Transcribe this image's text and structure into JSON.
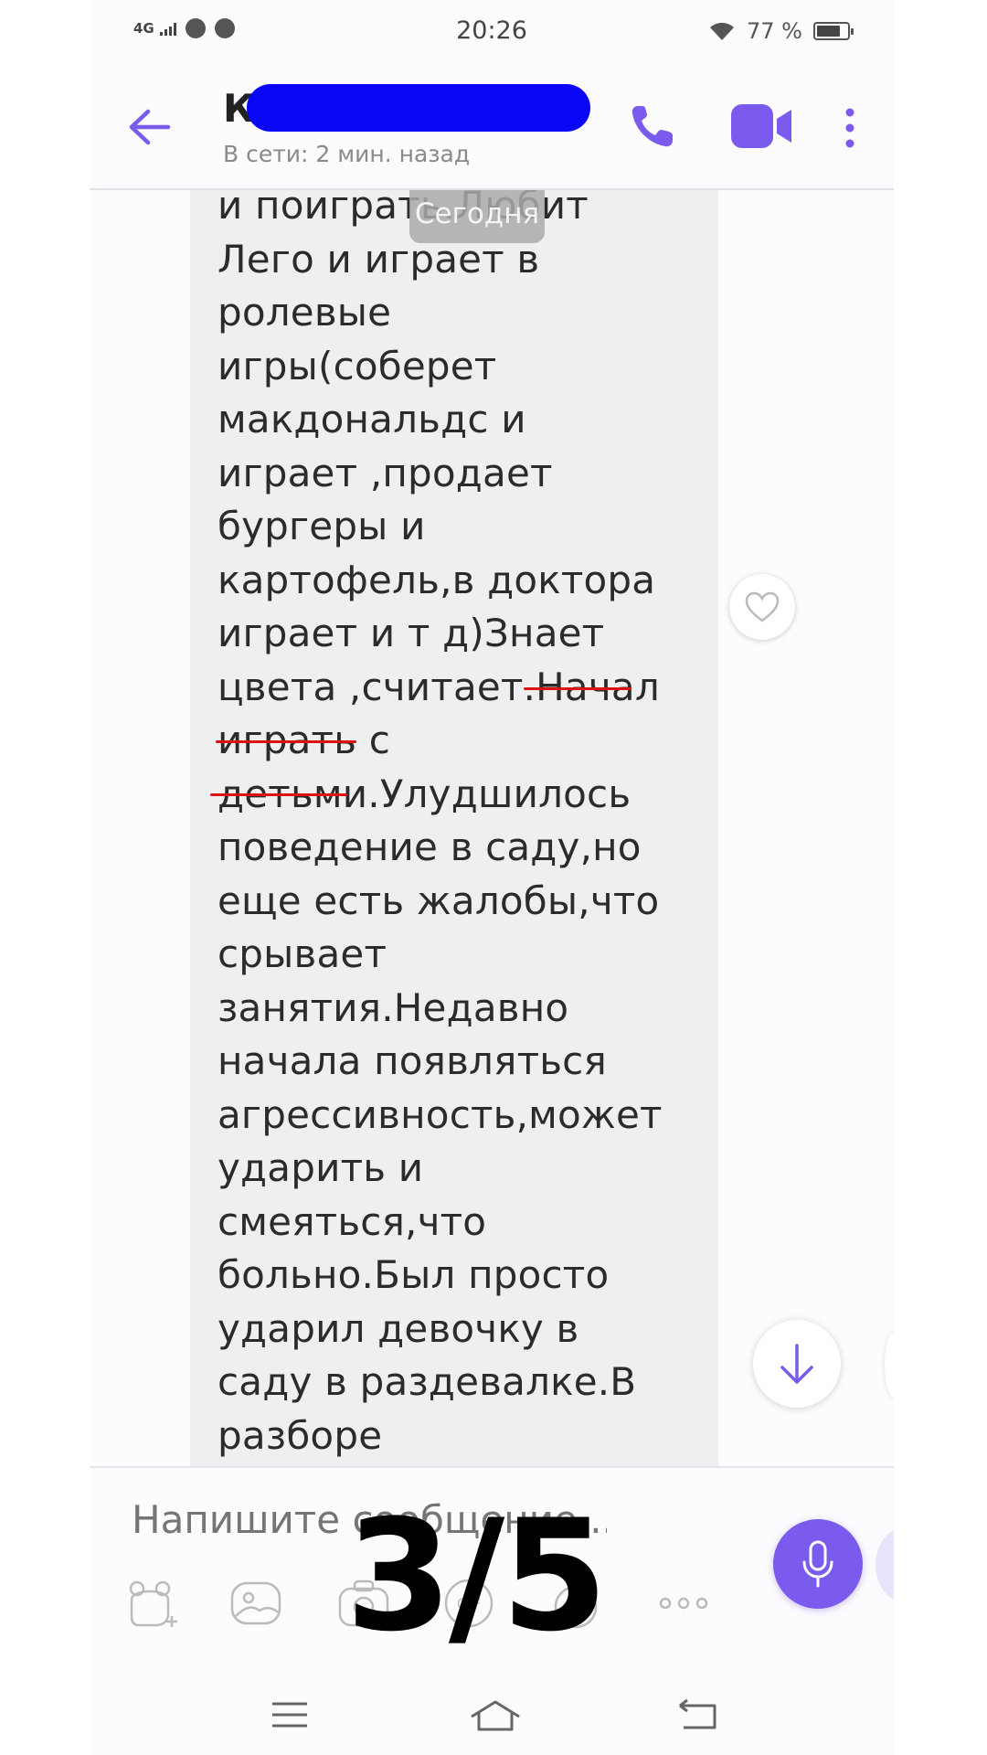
{
  "status_bar": {
    "network": "4G",
    "time": "20:26",
    "battery_text": "77 %",
    "battery_level": 0.77
  },
  "header": {
    "contact_initial": "К",
    "last_seen": "В сети: 2 мин. назад"
  },
  "chat": {
    "date_separator": "Сегодня",
    "message_text": "и поиграть.Любит\nЛего и играет в\nролевые\nигры(соберет\nмакдональдс и\nиграет ,продает\nбургеры и\nкартофель,в доктора\nиграет и т д)Знает\nцвета ,считает.Начал\nиграть с\nдетьми.Улудшилось\nповедение в саду,но\nеще есть жалобы,что\nсрывает\nзанятия.Недавно\nначала появляться\nагрессивность,может\nударить и\nсмеяться,что\nбольно.Был просто\nударил девочку в\nсаду в раздевалке.В\nразборе"
  },
  "composer": {
    "placeholder": "Напишите сообщение..."
  },
  "overlay": {
    "page_counter": "3/5"
  },
  "colors": {
    "accent": "#7b5bee",
    "redaction": "#0a07f6",
    "underline": "#e01010"
  }
}
